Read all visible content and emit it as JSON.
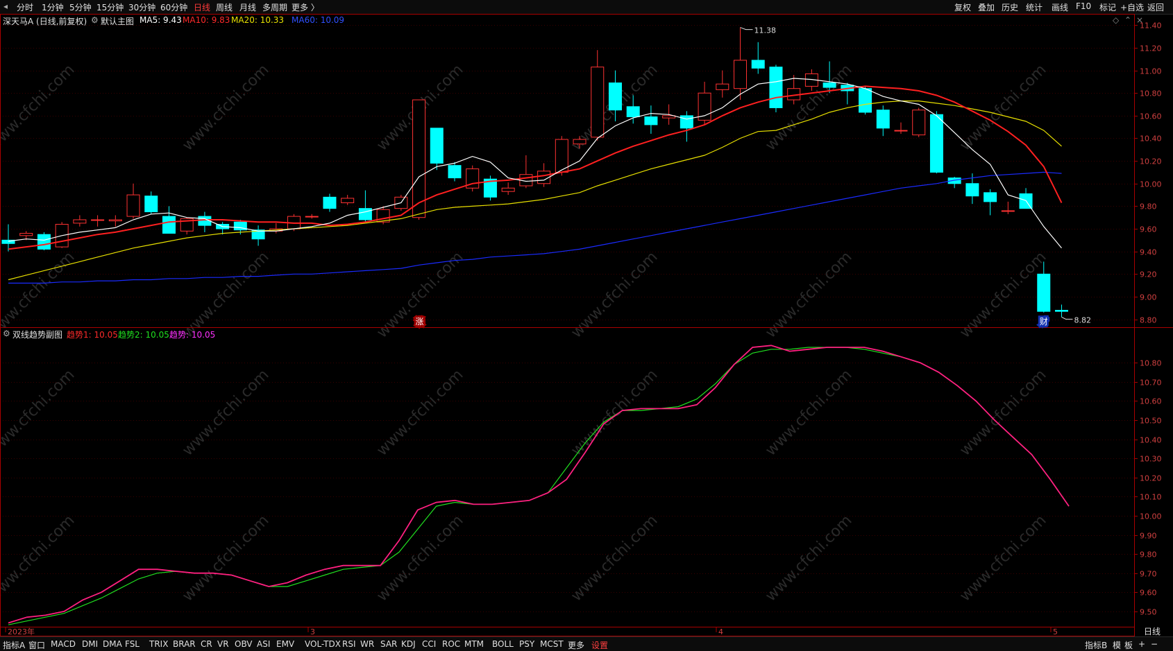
{
  "top_tabs": [
    "分时",
    "1分钟",
    "5分钟",
    "15分钟",
    "30分钟",
    "60分钟",
    "日线",
    "周线",
    "月线",
    "多周期",
    "更多 〉"
  ],
  "top_active": "日线",
  "right_tools": [
    "复权",
    "叠加",
    "历史",
    "统计",
    "画线",
    "F10",
    "标记",
    "+自选",
    "返回"
  ],
  "main_info": {
    "stock": "深天马A (日线,前复权)",
    "template": "默认主图",
    "ma5": "MA5: 9.43",
    "ma10": "MA10: 9.83",
    "ma20": "MA20: 10.33",
    "ma60": "MA60: 10.09"
  },
  "sub_info": {
    "title": "双线趋势副图",
    "q1": "趋势1: 10.05",
    "q2": "趋势2: 10.05",
    "q3": "趋势: 10.05"
  },
  "annotations": {
    "high": "11.38",
    "low": "8.82",
    "zhang": "涨",
    "cai": "财"
  },
  "watermark": "www.cfchi.com",
  "bottom_tabs": [
    "指标A",
    "窗口",
    "MACD",
    "DMI",
    "DMA",
    "FSL",
    "TRIX",
    "BRAR",
    "CR",
    "VR",
    "OBV",
    "ASI",
    "EMV",
    "VOL-TDX",
    "RSI",
    "WR",
    "SAR",
    "KDJ",
    "CCI",
    "ROC",
    "MTM",
    "BOLL",
    "PSY",
    "MCST",
    "更多",
    "设置"
  ],
  "bottom_right": [
    "指标B",
    "模",
    "板",
    "+",
    "−"
  ],
  "period_label": "日线",
  "date_labels": [
    "2023年",
    "3",
    "4",
    "5"
  ],
  "colors": {
    "up": "#ff3232",
    "down": "#00ffff",
    "ma5": "#ffffff",
    "ma10": "#ff2020",
    "ma20": "#e8e000",
    "ma60": "#1a2bff",
    "t1": "#ff2080",
    "t2": "#20e020",
    "axis": "#aa0000",
    "grid": "#3a0000"
  },
  "chart_data": {
    "type": "candlestick",
    "main_yticks": [
      11.4,
      11.2,
      11.0,
      10.8,
      10.6,
      10.4,
      10.2,
      10.0,
      9.8,
      9.6,
      9.4,
      9.2,
      9.0,
      8.8
    ],
    "main_ylim": [
      8.73,
      11.5
    ],
    "sub_yticks": [
      10.8,
      10.7,
      10.6,
      10.5,
      10.4,
      10.3,
      10.2,
      10.1,
      10.0,
      9.9,
      9.8,
      9.7,
      9.6,
      9.5
    ],
    "sub_ylim": [
      9.42,
      10.92
    ],
    "candles": [
      [
        9.5,
        9.47,
        9.64,
        9.4
      ],
      [
        9.54,
        9.56,
        9.58,
        9.5
      ],
      [
        9.55,
        9.42,
        9.57,
        9.41
      ],
      [
        9.44,
        9.64,
        9.66,
        9.43
      ],
      [
        9.65,
        9.68,
        9.72,
        9.62
      ],
      [
        9.68,
        9.68,
        9.72,
        9.62
      ],
      [
        9.67,
        9.68,
        9.72,
        9.62
      ],
      [
        9.71,
        9.9,
        10.0,
        9.69
      ],
      [
        9.89,
        9.75,
        9.93,
        9.73
      ],
      [
        9.71,
        9.56,
        9.8,
        9.56
      ],
      [
        9.58,
        9.69,
        9.7,
        9.55
      ],
      [
        9.71,
        9.63,
        9.75,
        9.57
      ],
      [
        9.64,
        9.6,
        9.66,
        9.55
      ],
      [
        9.66,
        9.59,
        9.68,
        9.55
      ],
      [
        9.59,
        9.51,
        9.63,
        9.45
      ],
      [
        9.58,
        9.6,
        9.65,
        9.56
      ],
      [
        9.6,
        9.71,
        9.73,
        9.58
      ],
      [
        9.71,
        9.71,
        9.73,
        9.69
      ],
      [
        9.88,
        9.78,
        9.91,
        9.75
      ],
      [
        9.83,
        9.87,
        9.9,
        9.81
      ],
      [
        9.78,
        9.68,
        9.94,
        9.66
      ],
      [
        9.66,
        9.77,
        9.8,
        9.64
      ],
      [
        9.78,
        9.88,
        9.9,
        9.76
      ],
      [
        9.7,
        10.74,
        10.74,
        9.68
      ],
      [
        10.49,
        10.18,
        10.49,
        10.12
      ],
      [
        10.16,
        10.05,
        10.19,
        10.02
      ],
      [
        9.96,
        10.13,
        10.16,
        9.93
      ],
      [
        10.04,
        9.88,
        10.07,
        9.85
      ],
      [
        9.93,
        9.96,
        10.01,
        9.9
      ],
      [
        9.98,
        10.08,
        10.25,
        9.96
      ],
      [
        10.0,
        10.11,
        10.18,
        9.97
      ],
      [
        10.1,
        10.39,
        10.42,
        10.07
      ],
      [
        10.35,
        10.39,
        10.42,
        10.31
      ],
      [
        10.41,
        11.03,
        11.18,
        10.38
      ],
      [
        10.89,
        10.65,
        11.0,
        10.55
      ],
      [
        10.68,
        10.59,
        10.78,
        10.53
      ],
      [
        10.59,
        10.52,
        10.69,
        10.44
      ],
      [
        10.58,
        10.6,
        10.7,
        10.52
      ],
      [
        10.6,
        10.49,
        10.64,
        10.37
      ],
      [
        10.56,
        10.8,
        10.9,
        10.52
      ],
      [
        10.83,
        10.88,
        11.0,
        10.76
      ],
      [
        10.84,
        11.09,
        11.38,
        10.74
      ],
      [
        11.09,
        11.02,
        11.25,
        10.97
      ],
      [
        11.03,
        10.67,
        11.05,
        10.63
      ],
      [
        10.74,
        10.84,
        10.96,
        10.7
      ],
      [
        10.86,
        10.97,
        11.01,
        10.82
      ],
      [
        10.89,
        10.85,
        11.08,
        10.8
      ],
      [
        10.87,
        10.82,
        10.89,
        10.7
      ],
      [
        10.84,
        10.63,
        10.86,
        10.61
      ],
      [
        10.65,
        10.49,
        10.69,
        10.42
      ],
      [
        10.47,
        10.47,
        10.54,
        10.44
      ],
      [
        10.43,
        10.65,
        10.67,
        10.41
      ],
      [
        10.61,
        10.1,
        10.64,
        10.09
      ],
      [
        10.05,
        10.0,
        10.06,
        9.96
      ],
      [
        10.0,
        9.89,
        10.09,
        9.82
      ],
      [
        9.92,
        9.84,
        9.95,
        9.72
      ],
      [
        9.76,
        9.76,
        9.84,
        9.73
      ],
      [
        9.91,
        9.78,
        9.96,
        9.78
      ],
      [
        9.2,
        8.87,
        9.31,
        8.86
      ],
      [
        8.88,
        8.87,
        8.93,
        8.82
      ]
    ],
    "ma5": [
      9.49,
      9.51,
      9.5,
      9.54,
      9.57,
      9.59,
      9.61,
      9.68,
      9.73,
      9.74,
      9.7,
      9.69,
      9.62,
      9.61,
      9.58,
      9.58,
      9.6,
      9.62,
      9.65,
      9.72,
      9.75,
      9.79,
      9.83,
      10.06,
      10.15,
      10.18,
      10.24,
      10.19,
      10.05,
      10.02,
      10.03,
      10.12,
      10.2,
      10.4,
      10.51,
      10.58,
      10.62,
      10.61,
      10.57,
      10.6,
      10.67,
      10.79,
      10.88,
      10.9,
      10.93,
      10.92,
      10.9,
      10.88,
      10.84,
      10.77,
      10.73,
      10.7,
      10.6,
      10.45,
      10.3,
      10.17,
      9.9,
      9.85,
      9.62,
      9.43
    ],
    "ma10": [
      9.42,
      9.44,
      9.46,
      9.49,
      9.52,
      9.55,
      9.57,
      9.6,
      9.63,
      9.66,
      9.67,
      9.68,
      9.68,
      9.67,
      9.66,
      9.66,
      9.65,
      9.65,
      9.63,
      9.64,
      9.66,
      9.69,
      9.72,
      9.83,
      9.9,
      9.95,
      10.0,
      10.02,
      10.03,
      10.05,
      10.07,
      10.1,
      10.13,
      10.2,
      10.27,
      10.33,
      10.38,
      10.43,
      10.47,
      10.52,
      10.6,
      10.67,
      10.72,
      10.76,
      10.78,
      10.8,
      10.82,
      10.84,
      10.86,
      10.85,
      10.84,
      10.82,
      10.78,
      10.72,
      10.64,
      10.56,
      10.46,
      10.34,
      10.15,
      9.83
    ],
    "ma20": [
      9.15,
      9.19,
      9.23,
      9.27,
      9.31,
      9.35,
      9.39,
      9.43,
      9.46,
      9.49,
      9.52,
      9.54,
      9.56,
      9.57,
      9.58,
      9.59,
      9.6,
      9.61,
      9.62,
      9.63,
      9.65,
      9.67,
      9.69,
      9.73,
      9.77,
      9.79,
      9.8,
      9.81,
      9.82,
      9.84,
      9.86,
      9.89,
      9.92,
      9.98,
      10.03,
      10.08,
      10.13,
      10.17,
      10.21,
      10.25,
      10.32,
      10.4,
      10.46,
      10.47,
      10.52,
      10.57,
      10.63,
      10.67,
      10.7,
      10.72,
      10.73,
      10.73,
      10.71,
      10.69,
      10.66,
      10.63,
      10.59,
      10.55,
      10.47,
      10.33
    ],
    "ma60": [
      9.12,
      9.12,
      9.12,
      9.13,
      9.13,
      9.14,
      9.14,
      9.15,
      9.15,
      9.16,
      9.16,
      9.17,
      9.17,
      9.18,
      9.18,
      9.19,
      9.2,
      9.2,
      9.21,
      9.22,
      9.23,
      9.24,
      9.25,
      9.28,
      9.3,
      9.32,
      9.33,
      9.35,
      9.36,
      9.37,
      9.38,
      9.4,
      9.42,
      9.45,
      9.48,
      9.51,
      9.54,
      9.57,
      9.6,
      9.63,
      9.66,
      9.69,
      9.72,
      9.75,
      9.78,
      9.81,
      9.84,
      9.87,
      9.9,
      9.93,
      9.96,
      9.98,
      10.0,
      10.03,
      10.05,
      10.07,
      10.08,
      10.09,
      10.1,
      10.09
    ],
    "trend1": [
      9.44,
      9.47,
      9.48,
      9.5,
      9.56,
      9.6,
      9.66,
      9.72,
      9.72,
      9.71,
      9.7,
      9.7,
      9.69,
      9.66,
      9.63,
      9.65,
      9.69,
      9.72,
      9.74,
      9.74,
      9.74,
      9.87,
      10.03,
      10.07,
      10.08,
      10.06,
      10.06,
      10.07,
      10.08,
      10.12,
      10.19,
      10.33,
      10.48,
      10.55,
      10.56,
      10.56,
      10.56,
      10.58,
      10.67,
      10.79,
      10.88,
      10.89,
      10.86,
      10.87,
      10.88,
      10.88,
      10.88,
      10.86,
      10.83,
      10.8,
      10.75,
      10.68,
      10.6,
      10.5,
      10.41,
      10.32,
      10.19,
      10.05
    ],
    "trend2": [
      9.43,
      9.45,
      9.47,
      9.49,
      9.53,
      9.57,
      9.62,
      9.67,
      9.7,
      9.71,
      9.7,
      9.7,
      9.69,
      9.66,
      9.63,
      9.63,
      9.66,
      9.69,
      9.72,
      9.73,
      9.74,
      9.81,
      9.93,
      10.05,
      10.07,
      10.06,
      10.06,
      10.07,
      10.08,
      10.12,
      10.25,
      10.38,
      10.49,
      10.55,
      10.55,
      10.56,
      10.57,
      10.61,
      10.69,
      10.79,
      10.85,
      10.87,
      10.87,
      10.88,
      10.88,
      10.88,
      10.87,
      10.85,
      10.83,
      10.8,
      10.75,
      10.68,
      10.6,
      10.5,
      10.41,
      10.32,
      10.19,
      10.05
    ]
  }
}
